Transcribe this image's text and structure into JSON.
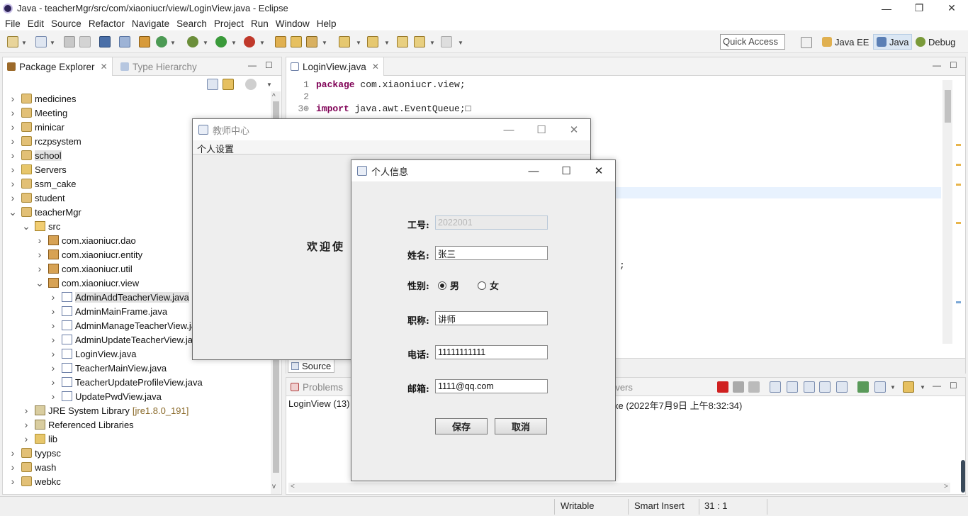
{
  "window": {
    "title": "Java - teacherMgr/src/com/xiaoniucr/view/LoginView.java - Eclipse",
    "controls": [
      "—",
      "❐",
      "✕"
    ]
  },
  "menu": [
    "File",
    "Edit",
    "Source",
    "Refactor",
    "Navigate",
    "Search",
    "Project",
    "Run",
    "Window",
    "Help"
  ],
  "toolbar": {
    "quick_access": "Quick Access",
    "perspectives": [
      "Java EE",
      "Java",
      "Debug"
    ]
  },
  "package_explorer": {
    "tab_label": "Package Explorer",
    "other_tab": "Type Hierarchy",
    "tree": [
      {
        "label": "medicines",
        "icon": "project",
        "depth": 0,
        "expand": ">"
      },
      {
        "label": "Meeting",
        "icon": "project",
        "depth": 0,
        "expand": ">"
      },
      {
        "label": "minicar",
        "icon": "project",
        "depth": 0,
        "expand": ">"
      },
      {
        "label": "rczpsystem",
        "icon": "project",
        "depth": 0,
        "expand": ">"
      },
      {
        "label": "school",
        "icon": "project",
        "depth": 0,
        "expand": ">",
        "selected": true
      },
      {
        "label": "Servers",
        "icon": "folder",
        "depth": 0,
        "expand": ">"
      },
      {
        "label": "ssm_cake",
        "icon": "project",
        "depth": 0,
        "expand": ">"
      },
      {
        "label": "student",
        "icon": "project",
        "depth": 0,
        "expand": ">"
      },
      {
        "label": "teacherMgr",
        "icon": "project",
        "depth": 0,
        "expand": "v"
      },
      {
        "label": "src",
        "icon": "src",
        "depth": 1,
        "expand": "v"
      },
      {
        "label": "com.xiaoniucr.dao",
        "icon": "pkg",
        "depth": 2,
        "expand": ">"
      },
      {
        "label": "com.xiaoniucr.entity",
        "icon": "pkg",
        "depth": 2,
        "expand": ">"
      },
      {
        "label": "com.xiaoniucr.util",
        "icon": "pkg",
        "depth": 2,
        "expand": ">"
      },
      {
        "label": "com.xiaoniucr.view",
        "icon": "pkg",
        "depth": 2,
        "expand": "v"
      },
      {
        "label": "AdminAddTeacherView.java",
        "icon": "java",
        "depth": 3,
        "expand": ">",
        "selected": true
      },
      {
        "label": "AdminMainFrame.java",
        "icon": "java",
        "depth": 3,
        "expand": ">"
      },
      {
        "label": "AdminManageTeacherView.ja",
        "icon": "java",
        "depth": 3,
        "expand": ">"
      },
      {
        "label": "AdminUpdateTeacherView.ja",
        "icon": "java",
        "depth": 3,
        "expand": ">"
      },
      {
        "label": "LoginView.java",
        "icon": "java",
        "depth": 3,
        "expand": ">"
      },
      {
        "label": "TeacherMainView.java",
        "icon": "java",
        "depth": 3,
        "expand": ">"
      },
      {
        "label": "TeacherUpdateProfileView.java",
        "icon": "java",
        "depth": 3,
        "expand": ">"
      },
      {
        "label": "UpdatePwdView.java",
        "icon": "java",
        "depth": 3,
        "expand": ">"
      },
      {
        "label": "JRE System Library",
        "decoration": "[jre1.8.0_191]",
        "icon": "lib",
        "depth": 1,
        "expand": ">"
      },
      {
        "label": "Referenced Libraries",
        "icon": "lib",
        "depth": 1,
        "expand": ">"
      },
      {
        "label": "lib",
        "icon": "folder",
        "depth": 1,
        "expand": ">"
      },
      {
        "label": "tyypsc",
        "icon": "project",
        "depth": 0,
        "expand": ">"
      },
      {
        "label": "wash",
        "icon": "project",
        "depth": 0,
        "expand": ">"
      },
      {
        "label": "webkc",
        "icon": "project",
        "depth": 0,
        "expand": ">"
      }
    ]
  },
  "editor": {
    "tab_label": "LoginView.java",
    "lines": [
      {
        "num": "1",
        "kw": "package",
        "text": " com.xiaoniucr.view;"
      },
      {
        "num": "2",
        "kw": "",
        "text": ""
      },
      {
        "num": "3⊕",
        "kw": "import",
        "text": " java.awt.EventQueue;□"
      }
    ],
    "trailing_semicolon": ";",
    "bottom_tabs": [
      "Source"
    ]
  },
  "console": {
    "tab_label": "Problems",
    "servers_fragment": "rvers",
    "line_left": "LoginView (13)",
    "line_right": "xe (2022年7月9日 上午8:32:34)"
  },
  "status": {
    "writable": "Writable",
    "insert_mode": "Smart Insert",
    "position": "31 : 1"
  },
  "teacher_center": {
    "title": "教师中心",
    "menu": "个人设置",
    "welcome": "欢迎使"
  },
  "personal_info": {
    "title": "个人信息",
    "fields": {
      "id_label": "工号:",
      "id_value": "2022001",
      "name_label": "姓名:",
      "name_value": "张三",
      "gender_label": "性别:",
      "gender_male": "男",
      "gender_female": "女",
      "title_label": "职称:",
      "title_value": "讲师",
      "phone_label": "电话:",
      "phone_value": "11111111111",
      "email_label": "邮箱:",
      "email_value": "1111@qq.com"
    },
    "selected_gender": "男",
    "save_label": "保存",
    "cancel_label": "取消"
  }
}
